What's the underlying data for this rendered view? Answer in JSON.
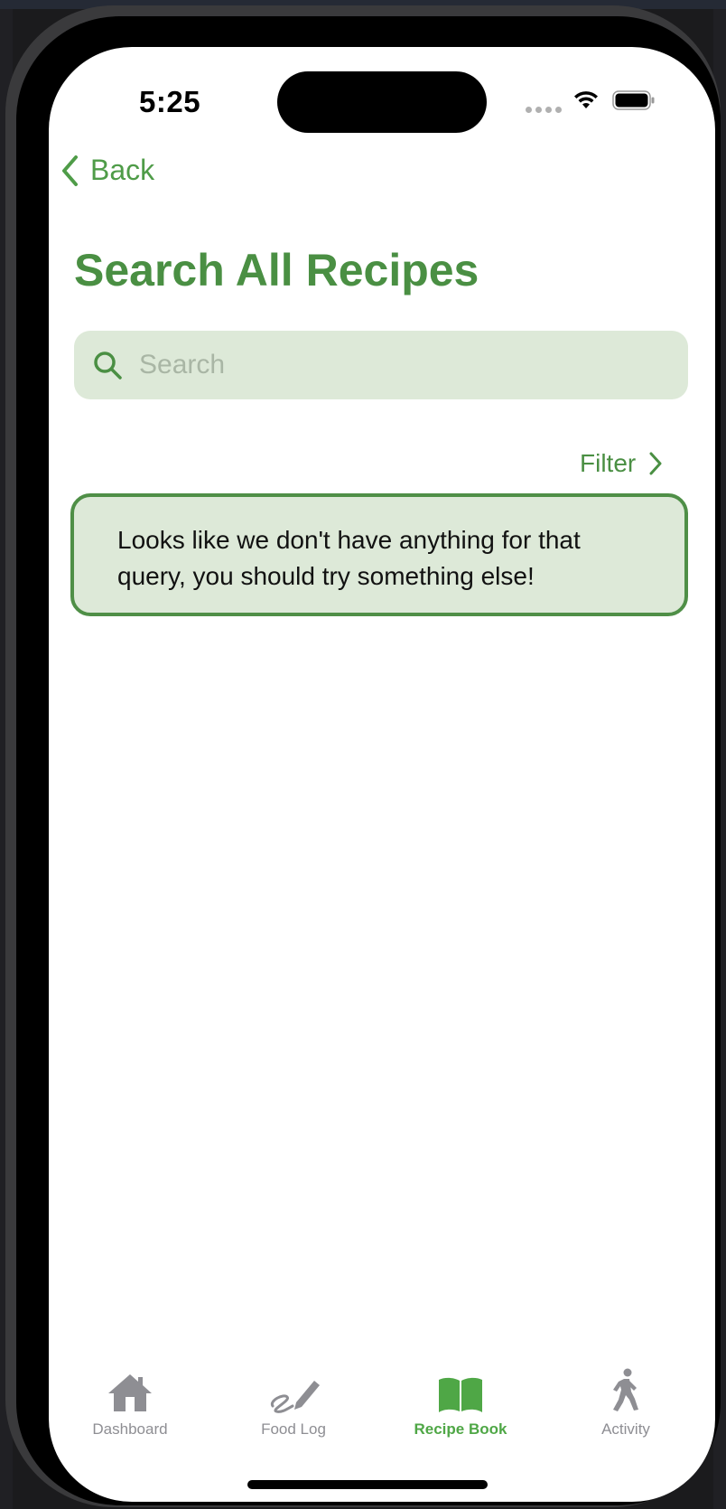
{
  "status_bar": {
    "time": "5:25"
  },
  "nav": {
    "back_label": "Back"
  },
  "page": {
    "title": "Search All Recipes"
  },
  "search": {
    "placeholder": "Search",
    "value": ""
  },
  "filter": {
    "label": "Filter"
  },
  "empty_state": {
    "message": "Looks like we don't have anything for that query, you should try something else!"
  },
  "tab_bar": {
    "tabs": [
      {
        "label": "Dashboard",
        "icon": "house-icon",
        "active": false
      },
      {
        "label": "Food Log",
        "icon": "pencil-scribble-icon",
        "active": false
      },
      {
        "label": "Recipe Book",
        "icon": "book-icon",
        "active": true
      },
      {
        "label": "Activity",
        "icon": "walking-figure-icon",
        "active": false
      }
    ]
  },
  "colors": {
    "accent": "#4a8f43",
    "active_tab": "#4fa746",
    "search_bg": "#dde9d8",
    "inactive_tab": "#8e8e93"
  }
}
